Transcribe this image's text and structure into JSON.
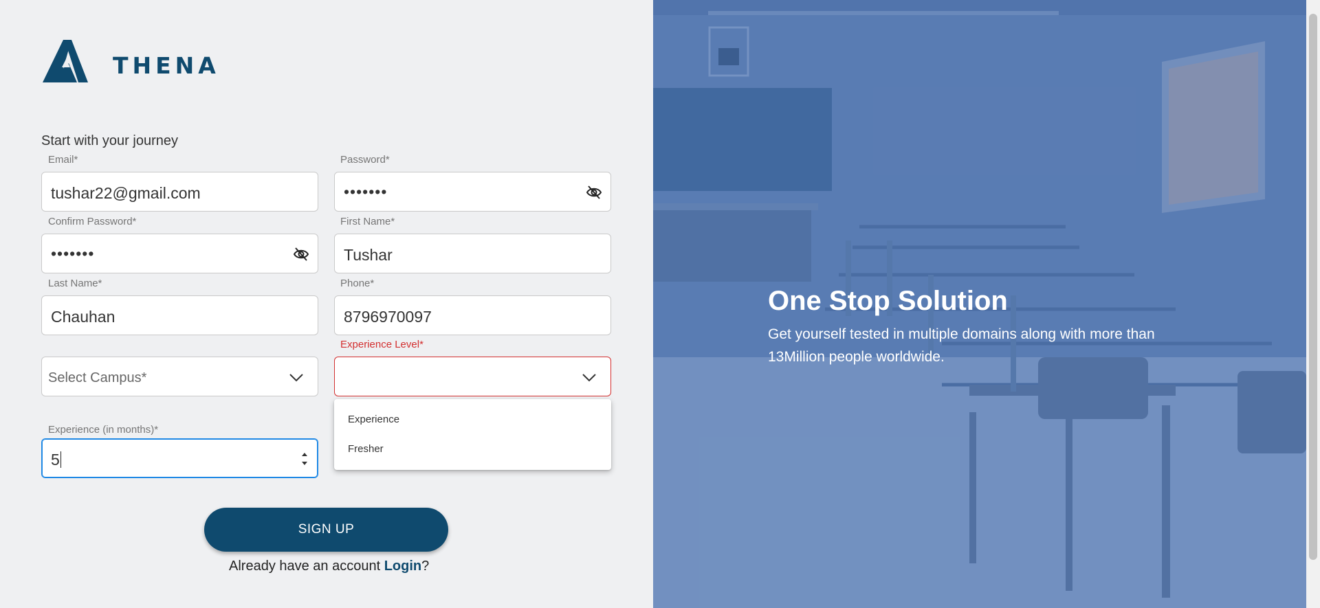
{
  "brand": {
    "name": "THENA"
  },
  "form": {
    "heading": "Start with your journey",
    "email": {
      "label": "Email*",
      "value": "tushar22@gmail.com"
    },
    "password": {
      "label": "Password*",
      "value": "•••••••"
    },
    "confirm_password": {
      "label": "Confirm Password*",
      "value": "•••••••"
    },
    "first_name": {
      "label": "First Name*",
      "value": "Tushar"
    },
    "last_name": {
      "label": "Last Name*",
      "value": "Chauhan"
    },
    "phone": {
      "label": "Phone*",
      "value": "8796970097"
    },
    "campus": {
      "placeholder": "Select Campus*"
    },
    "experience_level": {
      "label": "Experience Level*",
      "value": "",
      "options": [
        "Experience",
        "Fresher"
      ]
    },
    "experience_months": {
      "label": "Experience (in months)*",
      "value": "5"
    },
    "signup_label": "SIGN UP",
    "login_prompt": "Already have an account ",
    "login_link": "Login",
    "login_suffix": "?"
  },
  "hero": {
    "title": "One Stop Solution",
    "subtitle": "Get yourself tested in multiple domains along with more than 13Million people worldwide."
  },
  "colors": {
    "brand": "#0f4a6e",
    "error": "#d32f2f",
    "focus": "#1e88e5",
    "hero_overlay": "#5d7fb3"
  },
  "icons": [
    "athena-logo-icon",
    "eye-off-icon",
    "chevron-down-icon",
    "number-spinner-icon"
  ]
}
